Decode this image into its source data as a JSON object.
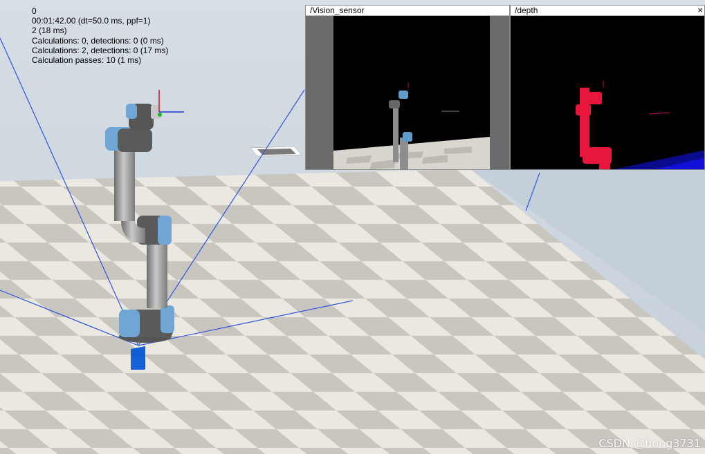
{
  "stats": {
    "lines": [
      "0",
      "00:01:42.00 (dt=50.0 ms, ppf=1)",
      "2 (18 ms)",
      "Calculations: 0, detections: 0 (0 ms)",
      "Calculations: 2, detections: 0 (17 ms)",
      "Calculation passes: 10 (1 ms)"
    ]
  },
  "views": {
    "vision": {
      "title": "/Vision_sensor"
    },
    "depth": {
      "title": "/depth",
      "close": "×"
    }
  },
  "watermark": "CSDN @hong3731",
  "colors": {
    "sky": "#c9d3dc",
    "floor_light": "#e9e6e0",
    "floor_dark": "#cbc8c2",
    "beam": "#2a52e0",
    "cube": "#1560d8",
    "robot_gray": "#8c8c8c",
    "robot_blue": "#5f9ccc",
    "depth_red": "#e8153c"
  }
}
